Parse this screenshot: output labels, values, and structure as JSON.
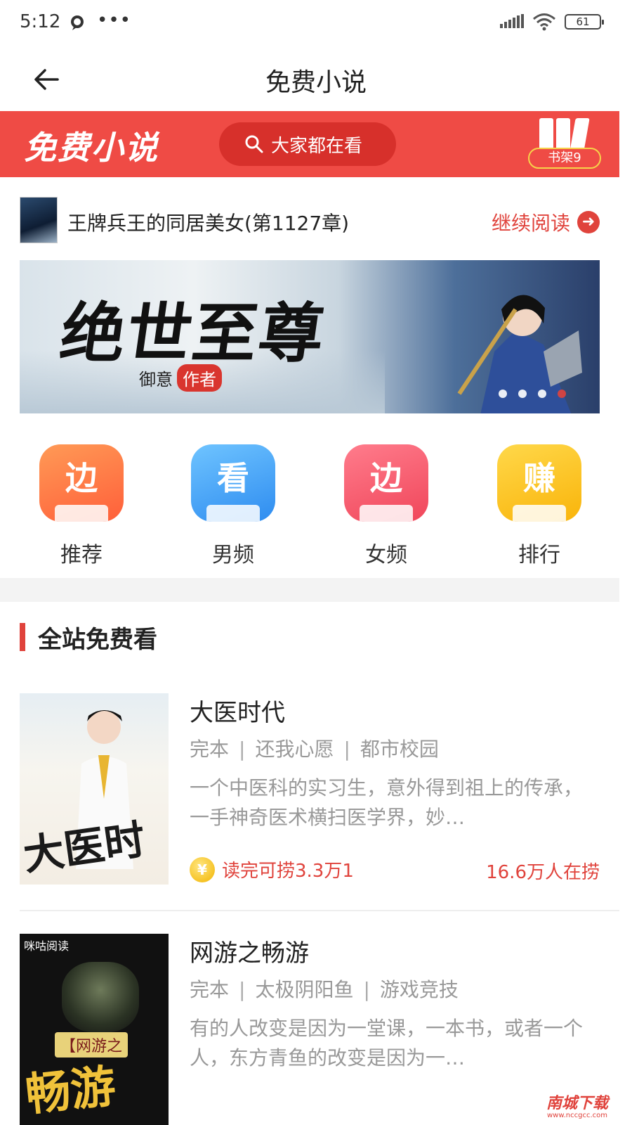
{
  "status_bar": {
    "time": "5:12",
    "more": "•••",
    "battery": "61"
  },
  "nav": {
    "title": "免费小说"
  },
  "banner": {
    "logo_text": "免费小说",
    "search_placeholder": "大家都在看",
    "shelf_label": "书架9",
    "accent": "#ef4b45"
  },
  "continue_reading": {
    "book": "王牌兵王的同居美女(第1127章)",
    "action": "继续阅读"
  },
  "hero": {
    "title": "绝世至尊",
    "author": "御意",
    "author_tag": "作者",
    "slides": 4,
    "active_slide": 4
  },
  "categories": [
    {
      "label": "推荐",
      "glyph": "边",
      "color_from": "#ff9a56",
      "color_to": "#ff5f3a"
    },
    {
      "label": "男频",
      "glyph": "看",
      "color_from": "#6fc4ff",
      "color_to": "#2e8cf0"
    },
    {
      "label": "女频",
      "glyph": "边",
      "color_from": "#ff7c8c",
      "color_to": "#f0465a"
    },
    {
      "label": "排行",
      "glyph": "赚",
      "color_from": "#ffd84a",
      "color_to": "#f9b40a"
    }
  ],
  "section": {
    "title": "全站免费看"
  },
  "books": [
    {
      "title": "大医时代",
      "status": "完本",
      "author": "还我心愿",
      "genre": "都市校园",
      "desc": "一个中医科的实习生，意外得到祖上的传承，一手神奇医术横扫医学界，妙…",
      "reward": "读完可捞3.3万1",
      "readers": "16.6万人在捞",
      "cover_text": "大医时代"
    },
    {
      "title": "网游之畅游",
      "status": "完本",
      "author": "太极阴阳鱼",
      "genre": "游戏竞技",
      "desc": "有的人改变是因为一堂课，一本书，或者一个人，东方青鱼的改变是因为一…",
      "cover_top": "咪咕阅读",
      "cover_tag": "【网游之",
      "cover_text": "畅游"
    }
  ],
  "watermark": {
    "main": "南城下载",
    "sub": "www.nccgcc.com"
  }
}
